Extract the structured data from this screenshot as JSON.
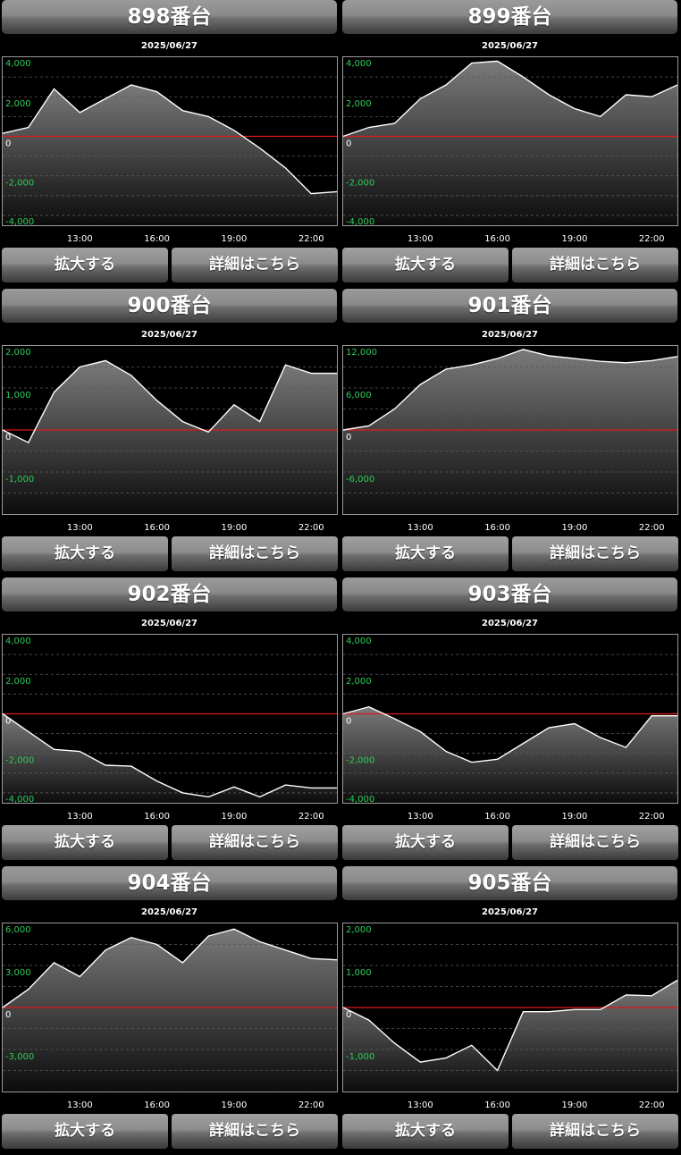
{
  "panels": [
    {
      "title": "898番台",
      "date": "2025/06/27",
      "zoom_label": "拡大する",
      "detail_label": "詳細はこちら",
      "chart_data": {
        "type": "area",
        "x": [
          "10:00",
          "11:00",
          "12:00",
          "13:00",
          "14:00",
          "15:00",
          "16:00",
          "17:00",
          "18:00",
          "19:00",
          "20:00",
          "21:00",
          "22:00",
          "23:00"
        ],
        "y": [
          150,
          450,
          2400,
          1200,
          1900,
          2600,
          2250,
          1300,
          1000,
          300,
          -600,
          -1600,
          -2900,
          -2800
        ],
        "ylim": [
          -4500,
          4000
        ],
        "yticks": [
          4000,
          2000,
          0,
          -2000,
          -4000
        ],
        "yticklabels": [
          "4,000",
          "2,000",
          "0",
          "-2,000",
          "-4,000"
        ],
        "xticks": [
          "13:00",
          "16:00",
          "19:00",
          "22:00"
        ],
        "grid": true
      }
    },
    {
      "title": "899番台",
      "date": "2025/06/27",
      "zoom_label": "拡大する",
      "detail_label": "詳細はこちら",
      "chart_data": {
        "type": "area",
        "x": [
          "10:00",
          "11:00",
          "12:00",
          "13:00",
          "14:00",
          "15:00",
          "16:00",
          "17:00",
          "18:00",
          "19:00",
          "20:00",
          "21:00",
          "22:00",
          "23:00"
        ],
        "y": [
          0,
          450,
          650,
          1900,
          2600,
          3700,
          3800,
          3000,
          2100,
          1400,
          1000,
          2100,
          2000,
          2600
        ],
        "ylim": [
          -4500,
          4000
        ],
        "yticks": [
          4000,
          2000,
          0,
          -2000,
          -4000
        ],
        "yticklabels": [
          "4,000",
          "2,000",
          "0",
          "-2,000",
          "-4,000"
        ],
        "xticks": [
          "13:00",
          "16:00",
          "19:00",
          "22:00"
        ],
        "grid": true
      }
    },
    {
      "title": "900番台",
      "date": "2025/06/27",
      "zoom_label": "拡大する",
      "detail_label": "詳細はこちら",
      "chart_data": {
        "type": "area",
        "x": [
          "10:00",
          "11:00",
          "12:00",
          "13:00",
          "14:00",
          "15:00",
          "16:00",
          "17:00",
          "18:00",
          "19:00",
          "20:00",
          "21:00",
          "22:00",
          "23:00"
        ],
        "y": [
          0,
          -300,
          900,
          1500,
          1650,
          1300,
          700,
          200,
          -50,
          600,
          200,
          1550,
          1350,
          1350
        ],
        "ylim": [
          -2000,
          2000
        ],
        "yticks": [
          2000,
          1000,
          0,
          -1000,
          -2000
        ],
        "yticklabels": [
          "2,000",
          "1,000",
          "0",
          "-1,000",
          "-2,000"
        ],
        "xticks": [
          "13:00",
          "16:00",
          "19:00",
          "22:00"
        ],
        "grid": true
      }
    },
    {
      "title": "901番台",
      "date": "2025/06/27",
      "zoom_label": "拡大する",
      "detail_label": "詳細はこちら",
      "chart_data": {
        "type": "area",
        "x": [
          "10:00",
          "11:00",
          "12:00",
          "13:00",
          "14:00",
          "15:00",
          "16:00",
          "17:00",
          "18:00",
          "19:00",
          "20:00",
          "21:00",
          "22:00",
          "23:00"
        ],
        "y": [
          0,
          600,
          3000,
          6500,
          8700,
          9300,
          10200,
          11500,
          10600,
          10200,
          9800,
          9600,
          9900,
          10500
        ],
        "ylim": [
          -12000,
          12000
        ],
        "yticks": [
          12000,
          6000,
          0,
          -6000,
          -12000
        ],
        "yticklabels": [
          "12,000",
          "6,000",
          "0",
          "-6,000",
          "-12,000"
        ],
        "xticks": [
          "13:00",
          "16:00",
          "19:00",
          "22:00"
        ],
        "grid": true
      }
    },
    {
      "title": "902番台",
      "date": "2025/06/27",
      "zoom_label": "拡大する",
      "detail_label": "詳細はこちら",
      "chart_data": {
        "type": "area",
        "x": [
          "10:00",
          "11:00",
          "12:00",
          "13:00",
          "14:00",
          "15:00",
          "16:00",
          "17:00",
          "18:00",
          "19:00",
          "20:00",
          "21:00",
          "22:00",
          "23:00"
        ],
        "y": [
          0,
          -900,
          -1800,
          -1900,
          -2600,
          -2650,
          -3400,
          -4000,
          -4200,
          -3700,
          -4200,
          -3600,
          -3750,
          -3750
        ],
        "ylim": [
          -4500,
          4000
        ],
        "yticks": [
          4000,
          2000,
          0,
          -2000,
          -4000
        ],
        "yticklabels": [
          "4,000",
          "2,000",
          "0",
          "-2,000",
          "-4,000"
        ],
        "xticks": [
          "13:00",
          "16:00",
          "19:00",
          "22:00"
        ],
        "grid": true
      }
    },
    {
      "title": "903番台",
      "date": "2025/06/27",
      "zoom_label": "拡大する",
      "detail_label": "詳細はこちら",
      "chart_data": {
        "type": "area",
        "x": [
          "10:00",
          "11:00",
          "12:00",
          "13:00",
          "14:00",
          "15:00",
          "16:00",
          "17:00",
          "18:00",
          "19:00",
          "20:00",
          "21:00",
          "22:00",
          "23:00"
        ],
        "y": [
          0,
          350,
          -250,
          -900,
          -1900,
          -2450,
          -2300,
          -1500,
          -700,
          -500,
          -1200,
          -1700,
          -100,
          -100
        ],
        "ylim": [
          -4500,
          4000
        ],
        "yticks": [
          4000,
          2000,
          0,
          -2000,
          -4000
        ],
        "yticklabels": [
          "4,000",
          "2,000",
          "0",
          "-2,000",
          "-4,000"
        ],
        "xticks": [
          "13:00",
          "16:00",
          "19:00",
          "22:00"
        ],
        "grid": true
      }
    },
    {
      "title": "904番台",
      "date": "2025/06/27",
      "zoom_label": "拡大する",
      "detail_label": "詳細はこちら",
      "chart_data": {
        "type": "area",
        "x": [
          "10:00",
          "11:00",
          "12:00",
          "13:00",
          "14:00",
          "15:00",
          "16:00",
          "17:00",
          "18:00",
          "19:00",
          "20:00",
          "21:00",
          "22:00",
          "23:00"
        ],
        "y": [
          0,
          1300,
          3200,
          2200,
          4100,
          5000,
          4500,
          3200,
          5100,
          5600,
          4700,
          4100,
          3500,
          3400
        ],
        "ylim": [
          -6000,
          6000
        ],
        "yticks": [
          6000,
          3000,
          0,
          -3000,
          -6000
        ],
        "yticklabels": [
          "6,000",
          "3,000",
          "0",
          "-3,000",
          "-6,000"
        ],
        "xticks": [
          "13:00",
          "16:00",
          "19:00",
          "22:00"
        ],
        "grid": true
      }
    },
    {
      "title": "905番台",
      "date": "2025/06/27",
      "zoom_label": "拡大する",
      "detail_label": "詳細はこちら",
      "chart_data": {
        "type": "area",
        "x": [
          "10:00",
          "11:00",
          "12:00",
          "13:00",
          "14:00",
          "15:00",
          "16:00",
          "17:00",
          "18:00",
          "19:00",
          "20:00",
          "21:00",
          "22:00",
          "23:00"
        ],
        "y": [
          0,
          -300,
          -850,
          -1300,
          -1200,
          -900,
          -1500,
          -100,
          -100,
          -50,
          -50,
          300,
          280,
          650
        ],
        "ylim": [
          -2000,
          2000
        ],
        "yticks": [
          2000,
          1000,
          0,
          -1000,
          -2000
        ],
        "yticklabels": [
          "2,000",
          "1,000",
          "0",
          "-1,000",
          "-2,000"
        ],
        "xticks": [
          "13:00",
          "16:00",
          "19:00",
          "22:00"
        ],
        "grid": true
      }
    }
  ],
  "colors": {
    "line": "#ffffff",
    "zero_line": "#e01818",
    "grid": "#5a5a5a",
    "ytick": "#2ecc5a",
    "xtick": "#ffffff",
    "zero_label": "#ffffff"
  }
}
